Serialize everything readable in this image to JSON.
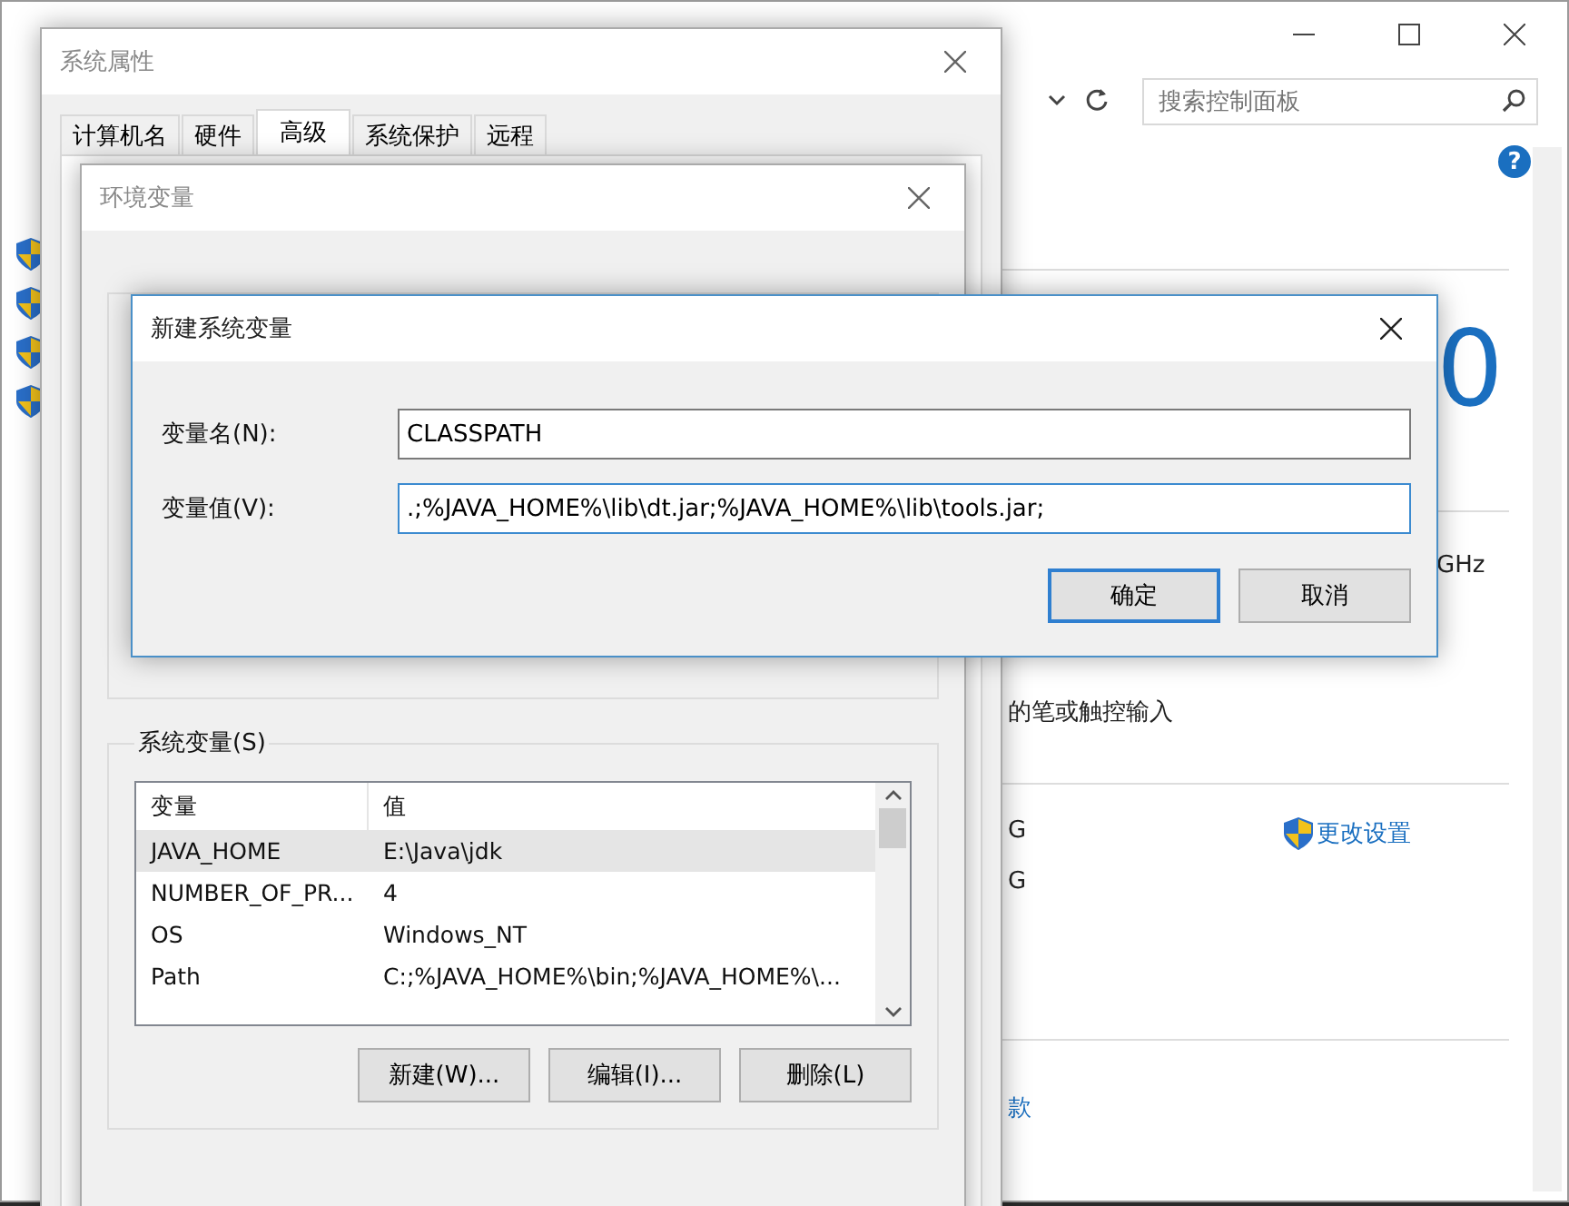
{
  "control_panel": {
    "search": {
      "placeholder": "搜索控制面板"
    },
    "help": "?",
    "fragments": [
      {
        "kind": "big",
        "text": "0"
      },
      {
        "kind": "plain",
        "text": "GHz"
      },
      {
        "kind": "plain",
        "text": "的笔或触控输入"
      },
      {
        "kind": "plain",
        "text": "G"
      },
      {
        "kind": "plain",
        "text": "G"
      },
      {
        "kind": "link",
        "text": "更改设置"
      },
      {
        "kind": "link",
        "text": "款"
      }
    ]
  },
  "system_properties": {
    "title": "系统属性",
    "tabs": [
      {
        "label": "计算机名",
        "selected": false
      },
      {
        "label": "硬件",
        "selected": false
      },
      {
        "label": "高级",
        "selected": true
      },
      {
        "label": "系统保护",
        "selected": false
      },
      {
        "label": "远程",
        "selected": false
      }
    ]
  },
  "environment_variables": {
    "title": "环境变量",
    "system_variables": {
      "label": "系统变量(S)",
      "columns": [
        "变量",
        "值"
      ],
      "rows": [
        {
          "name": "JAVA_HOME",
          "value": "E:\\Java\\jdk",
          "selected": true
        },
        {
          "name": "NUMBER_OF_PR...",
          "value": "4",
          "selected": false
        },
        {
          "name": "OS",
          "value": "Windows_NT",
          "selected": false
        },
        {
          "name": "Path",
          "value": "C:;%JAVA_HOME%\\bin;%JAVA_HOME%\\...",
          "selected": false
        }
      ],
      "buttons": [
        "新建(W)...",
        "编辑(I)...",
        "删除(L)"
      ]
    }
  },
  "new_system_variable": {
    "title": "新建系统变量",
    "fields": [
      {
        "label": "变量名(N):",
        "value": "CLASSPATH",
        "focused": false
      },
      {
        "label": "变量值(V):",
        "value": ".;%JAVA_HOME%\\lib\\dt.jar;%JAVA_HOME%\\lib\\tools.jar;",
        "focused": true
      }
    ],
    "buttons": [
      {
        "label": "确定",
        "default": true
      },
      {
        "label": "取消",
        "default": false
      }
    ]
  }
}
